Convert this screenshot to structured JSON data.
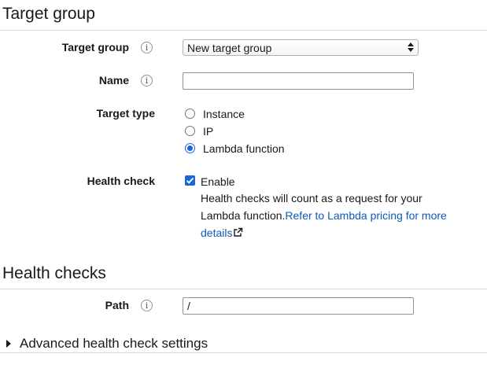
{
  "sections": {
    "target_group_title": "Target group",
    "health_checks_title": "Health checks"
  },
  "fields": {
    "target_group_label": "Target group",
    "target_group_value": "New target group",
    "name_label": "Name",
    "name_value": "",
    "target_type_label": "Target type",
    "target_type_options": [
      "Instance",
      "IP",
      "Lambda function"
    ],
    "target_type_selected": "Lambda function",
    "health_check_label": "Health check",
    "health_check_enable_label": "Enable",
    "health_check_enabled": true,
    "health_check_desc_1": "Health checks will count as a request for your",
    "health_check_desc_2": "Lambda function.",
    "health_check_link_1": "Refer to Lambda pricing for more",
    "health_check_link_2": "details",
    "path_label": "Path",
    "path_value": "/",
    "info_glyph": "i"
  },
  "advanced": {
    "label": "Advanced health check settings",
    "expanded": false
  },
  "colors": {
    "accent": "#1a66d6",
    "link": "#0f5bb5",
    "divider": "#d5dbdb"
  }
}
